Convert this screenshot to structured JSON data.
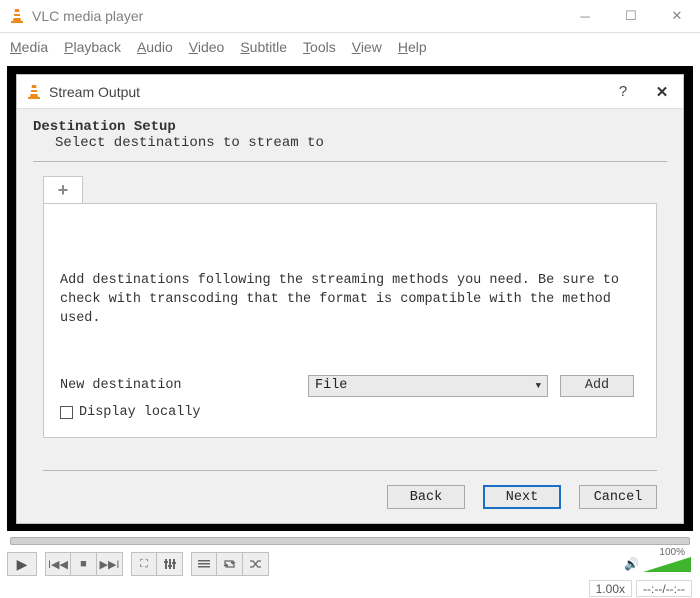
{
  "window": {
    "title": "VLC media player"
  },
  "menu": {
    "items": [
      "Media",
      "Playback",
      "Audio",
      "Video",
      "Subtitle",
      "Tools",
      "View",
      "Help"
    ]
  },
  "dialog": {
    "title": "Stream Output",
    "heading": "Destination Setup",
    "subheading": "Select destinations to stream to",
    "instruction": "Add destinations following the streaming methods you need. Be sure to check with transcoding that the format is compatible with the method used.",
    "new_destination_label": "New destination",
    "destination_select": "File",
    "add_label": "Add",
    "display_locally_label": "Display locally",
    "back_label": "Back",
    "next_label": "Next",
    "cancel_label": "Cancel",
    "tab_plus": "+"
  },
  "status": {
    "speed": "1.00x",
    "time": "--:--/--:--",
    "volume_label": "100%"
  }
}
